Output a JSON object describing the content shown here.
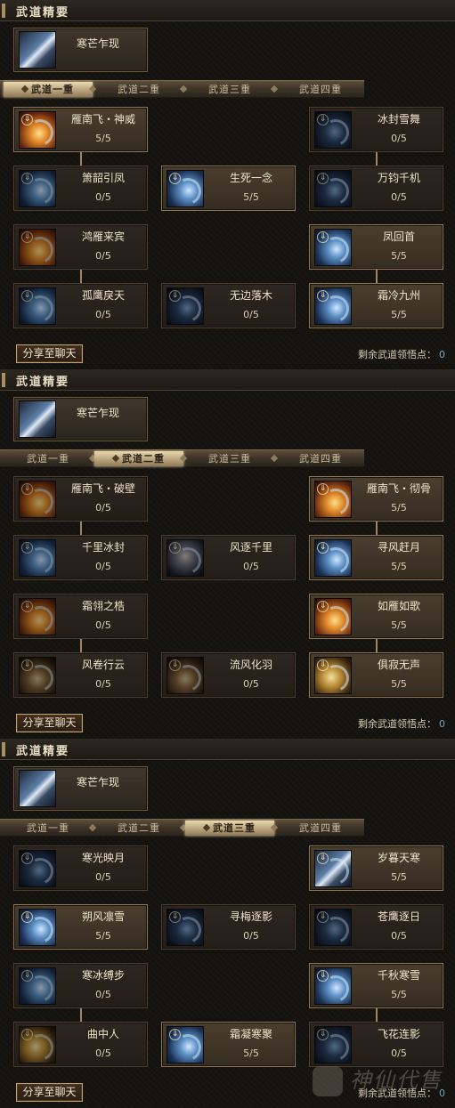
{
  "panels": [
    {
      "header": "武道精要",
      "essence": "寒芒乍现",
      "tabs": [
        "武道一重",
        "武道二重",
        "武道三重",
        "武道四重"
      ],
      "active_tab": 0,
      "cards": [
        {
          "name": "雁南飞・神威",
          "points": "5/5",
          "icon": "i-fire",
          "learned": true
        },
        {
          "name": "冰封雪舞",
          "points": "0/5",
          "icon": "i-dark",
          "learned": false
        },
        {
          "name": "箫韶引凤",
          "points": "0/5",
          "icon": "i-ice",
          "learned": false
        },
        {
          "name": "生死一念",
          "points": "5/5",
          "icon": "i-ice",
          "learned": true
        },
        {
          "name": "万钧千机",
          "points": "0/5",
          "icon": "i-dark",
          "learned": false
        },
        {
          "name": "鸿雁来宾",
          "points": "0/5",
          "icon": "i-fire",
          "learned": false
        },
        {
          "name": "凤回首",
          "points": "5/5",
          "icon": "i-ice",
          "learned": true
        },
        {
          "name": "孤鹰戾天",
          "points": "0/5",
          "icon": "i-ice",
          "learned": false
        },
        {
          "name": "无边落木",
          "points": "0/5",
          "icon": "i-dark",
          "learned": false
        },
        {
          "name": "霜冷九州",
          "points": "5/5",
          "icon": "i-ice",
          "learned": true
        }
      ],
      "share": "分享至聊天",
      "remain_label": "剩余武道领悟点：",
      "remain_value": "0"
    },
    {
      "header": "武道精要",
      "essence": "寒芒乍现",
      "tabs": [
        "武道一重",
        "武道二重",
        "武道三重",
        "武道四重"
      ],
      "active_tab": 1,
      "cards": [
        {
          "name": "雁南飞・破壁",
          "points": "0/5",
          "icon": "i-fire",
          "learned": false
        },
        {
          "name": "雁南飞・彻骨",
          "points": "5/5",
          "icon": "i-fire",
          "learned": true
        },
        {
          "name": "千里冰封",
          "points": "0/5",
          "icon": "i-ice",
          "learned": false
        },
        {
          "name": "风逐千里",
          "points": "0/5",
          "icon": "i-face",
          "learned": false
        },
        {
          "name": "寻风赶月",
          "points": "5/5",
          "icon": "i-ice",
          "learned": true
        },
        {
          "name": "霜翎之梏",
          "points": "0/5",
          "icon": "i-fire",
          "learned": false
        },
        {
          "name": "如雁如歌",
          "points": "5/5",
          "icon": "i-fire",
          "learned": true
        },
        {
          "name": "风卷行云",
          "points": "0/5",
          "icon": "i-wind",
          "learned": false
        },
        {
          "name": "流风化羽",
          "points": "0/5",
          "icon": "i-wind",
          "learned": false
        },
        {
          "name": "俱寂无声",
          "points": "5/5",
          "icon": "i-gold",
          "learned": true
        }
      ],
      "share": "分享至聊天",
      "remain_label": "剩余武道领悟点：",
      "remain_value": "0"
    },
    {
      "header": "武道精要",
      "essence": "寒芒乍现",
      "tabs": [
        "武道一重",
        "武道二重",
        "武道三重",
        "武道四重"
      ],
      "active_tab": 2,
      "cards": [
        {
          "name": "寒光映月",
          "points": "0/5",
          "icon": "i-dark",
          "learned": false
        },
        {
          "name": "岁暮天寒",
          "points": "5/5",
          "icon": "i-blade",
          "learned": true
        },
        {
          "name": "朔风凛雪",
          "points": "5/5",
          "icon": "i-ice",
          "learned": true
        },
        {
          "name": "寻梅逐影",
          "points": "0/5",
          "icon": "i-dark",
          "learned": false
        },
        {
          "name": "苍鹰逐日",
          "points": "0/5",
          "icon": "i-dark",
          "learned": false
        },
        {
          "name": "寒冰缚步",
          "points": "0/5",
          "icon": "i-ice",
          "learned": false
        },
        {
          "name": "千秋寒雪",
          "points": "5/5",
          "icon": "i-ice",
          "learned": true
        },
        {
          "name": "曲中人",
          "points": "0/5",
          "icon": "i-gold",
          "learned": false
        },
        {
          "name": "霜凝寒聚",
          "points": "5/5",
          "icon": "i-ice",
          "learned": true
        },
        {
          "name": "飞花连影",
          "points": "0/5",
          "icon": "i-dark",
          "learned": false
        }
      ],
      "share": "分享至聊天",
      "remain_label": "剩余武道领悟点：",
      "remain_value": "0"
    }
  ],
  "watermark": "神仙代售"
}
